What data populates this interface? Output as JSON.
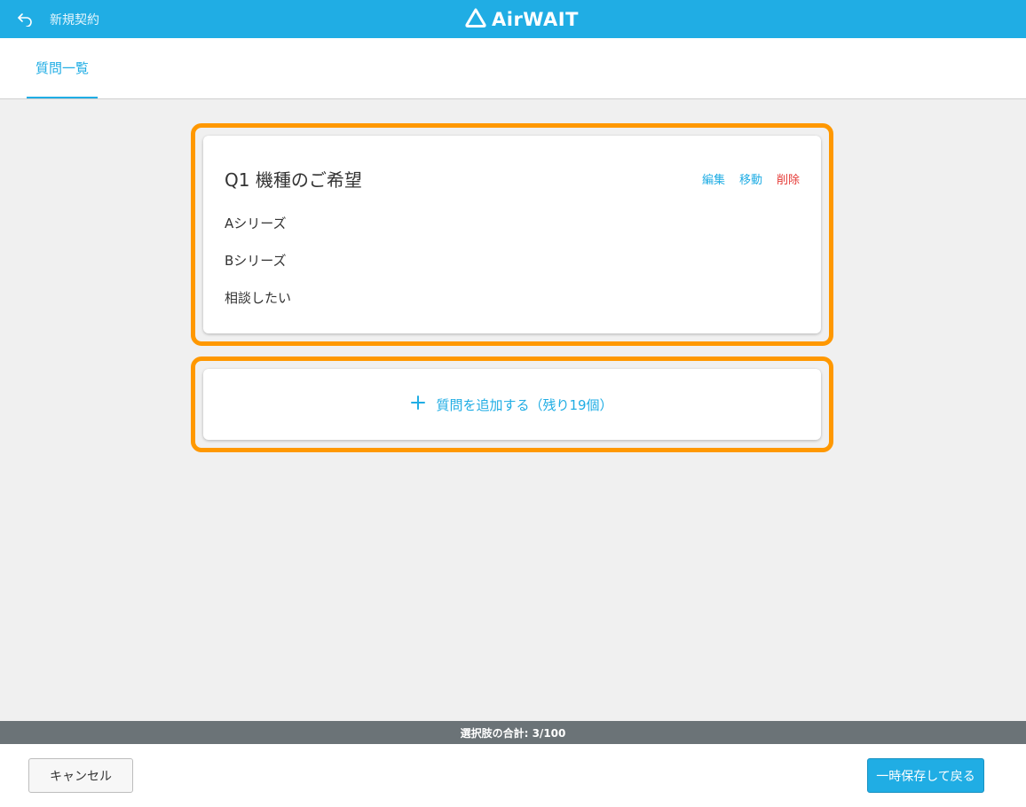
{
  "header": {
    "back_label": "新規契約",
    "logo_text": "AirWAIT"
  },
  "tabs": [
    {
      "label": "質問一覧",
      "active": true
    }
  ],
  "question": {
    "title": "Q1 機種のご希望",
    "actions": {
      "edit": "編集",
      "move": "移動",
      "delete": "削除"
    },
    "options": [
      "Aシリーズ",
      "Bシリーズ",
      "相談したい"
    ]
  },
  "add_question": {
    "label": "質問を追加する（残り19個）"
  },
  "status": {
    "text": "選択肢の合計: 3/100"
  },
  "footer": {
    "cancel_label": "キャンセル",
    "save_label": "一時保存して戻る"
  },
  "colors": {
    "brand": "#20ade4",
    "highlight": "#ff9800",
    "danger": "#e53935"
  },
  "icons": [
    "back-arrow-icon",
    "airwait-logo-icon",
    "plus-icon"
  ]
}
